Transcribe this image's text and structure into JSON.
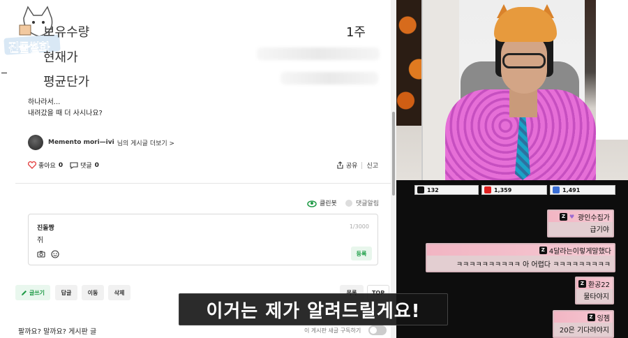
{
  "browser": {
    "logo_text": "진돌썰화",
    "table": [
      {
        "label": "보유수량",
        "value": "1주"
      },
      {
        "label": "현재가",
        "value": ""
      },
      {
        "label": "평균단가",
        "value": ""
      }
    ],
    "body_lines": [
      "하나라서...",
      "내려갔을 때 더 사시나요?"
    ],
    "author_name": "Memento mori—ivi",
    "author_suffix": "님의 게시글 더보기 >",
    "like_label": "좋아요",
    "like_count": "0",
    "comment_label": "댓글",
    "comment_count": "0",
    "share_label": "공유",
    "report_label": "신고",
    "cleanbot_label": "클린봇",
    "comment_alert_label": "댓글알림",
    "comment_box": {
      "name": "진돌짱",
      "counter": "1/3000",
      "text": "쥐",
      "submit_label": "등록"
    },
    "buttons": {
      "write": "글쓰기",
      "reply": "답글",
      "move": "이동",
      "delete": "삭제",
      "list": "목록",
      "top": "TOP"
    },
    "footer_text": "팔까요? 말까요?  게시판 글",
    "footer_toggle_label": "이 게시판 새글 구독하기"
  },
  "stream": {
    "stats": [
      {
        "icon": "chzzk-icon",
        "value": "132",
        "color": "#111111"
      },
      {
        "icon": "youtube-icon",
        "value": "1,359",
        "color": "#e02020"
      },
      {
        "icon": "viewer-icon",
        "value": "1,491",
        "color": "#3b6fd6"
      }
    ],
    "chats": [
      {
        "user": "광인수집가",
        "message": "급기야"
      },
      {
        "user": "4달라는이렇게말했다",
        "message": "ㅋㅋㅋㅋㅋㅋㅋㅋㅋㅋ 아 어렵다 ㅋㅋㅋㅋㅋㅋㅋㅋㅋ"
      },
      {
        "user": "환공22",
        "message": "물타야지"
      },
      {
        "user": "잉젬",
        "message": "20은 기다려야지"
      }
    ]
  },
  "subtitle": "이거는 제가 알려드릴게요!"
}
